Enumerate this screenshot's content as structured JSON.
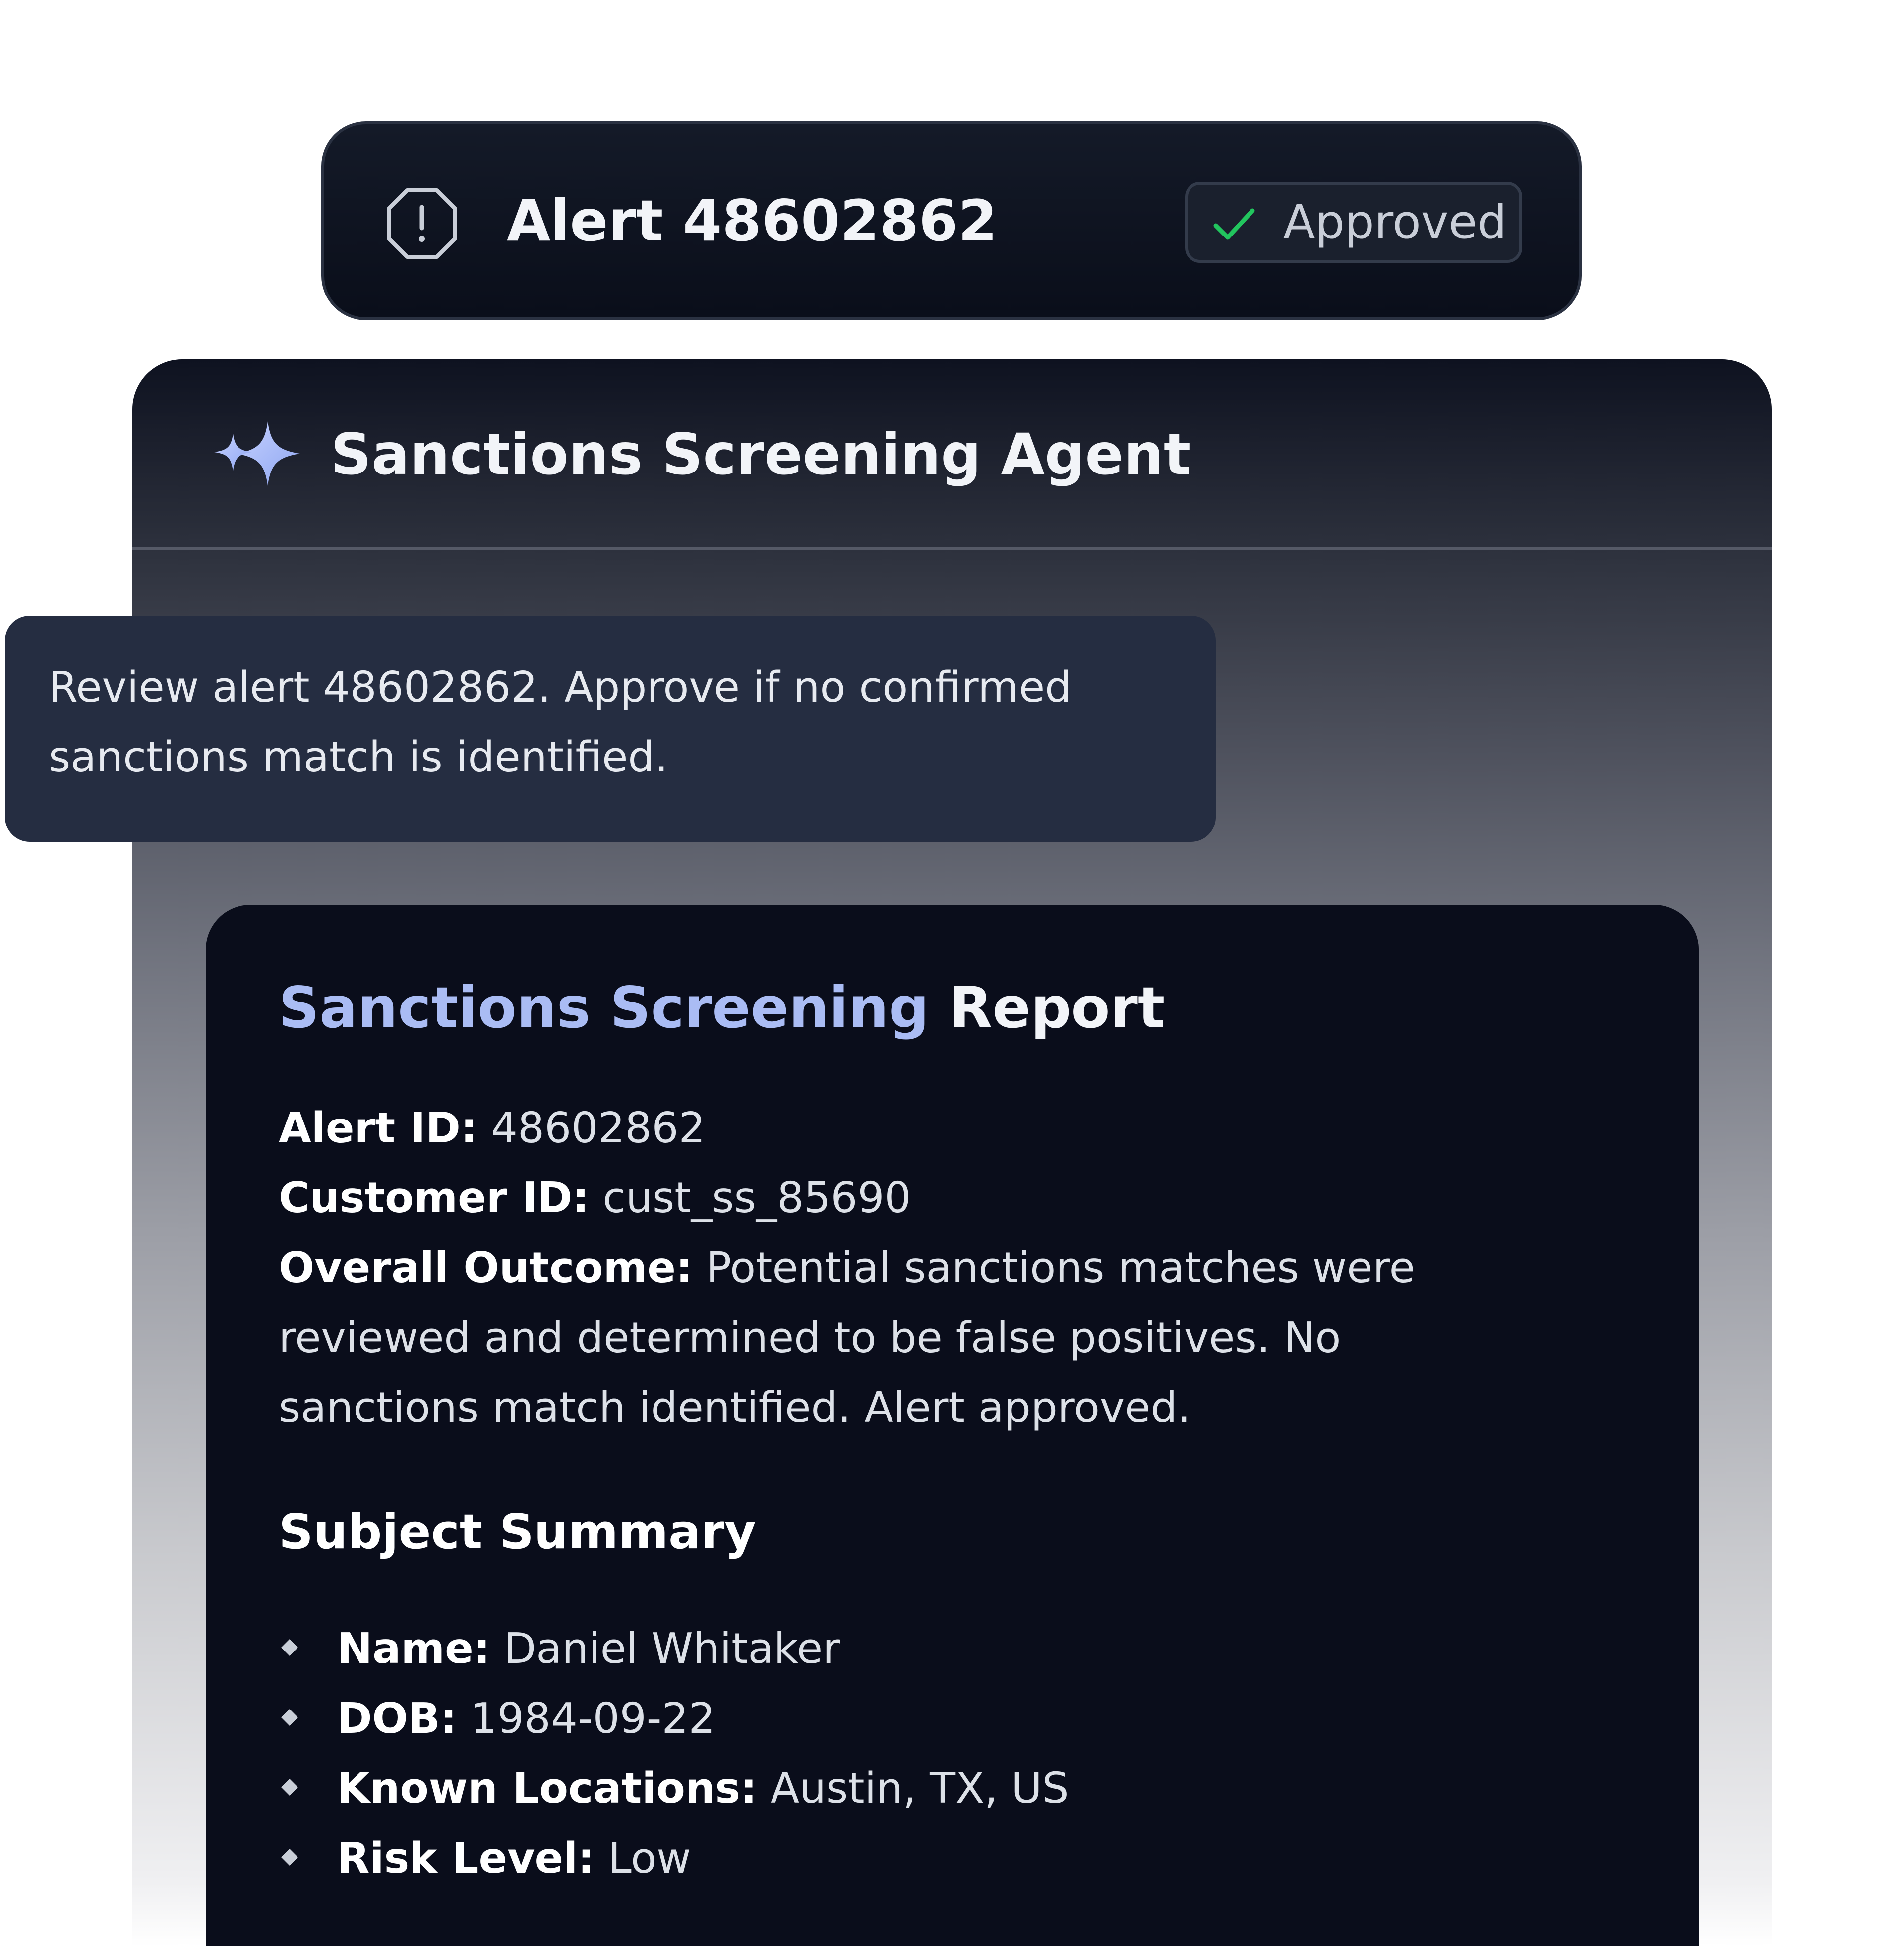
{
  "alert": {
    "title": "Alert 48602862",
    "status": "Approved",
    "status_color": "#22c55e",
    "icon": "alert-octagon-icon"
  },
  "agent": {
    "title": "Sanctions Screening Agent",
    "icon": "sparkle-icon",
    "accent_color": "#a9b9f4"
  },
  "prompt": {
    "text": "Review alert 48602862. Approve if no confirmed sanctions match is identified."
  },
  "report": {
    "title_part1": "Sanctions Screening ",
    "title_part2": "Report",
    "alert_id_label": "Alert ID:",
    "alert_id_value": " 48602862",
    "customer_id_label": "Customer ID:",
    "customer_id_value": " cust_ss_85690",
    "outcome_label": "Overall Outcome:",
    "outcome_value": " Potential sanctions matches were reviewed and determined to be false positives. No sanctions match identified. Alert approved.",
    "subject_summary_heading": "Subject Summary",
    "subject_summary": [
      {
        "label": "Name:",
        "value": " Daniel Whitaker"
      },
      {
        "label": "DOB:",
        "value": " 1984-09-22"
      },
      {
        "label": "Known Locations:",
        "value": " Austin, TX, US"
      },
      {
        "label": "Risk Level:",
        "value": " Low"
      }
    ]
  }
}
